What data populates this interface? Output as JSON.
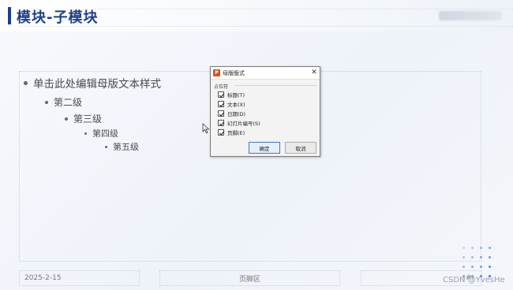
{
  "slide": {
    "title": "模块-子模块",
    "levels": [
      "单击此处编辑母版文本样式",
      "第二级",
      "第三级",
      "第四级",
      "第五级"
    ],
    "footer": {
      "date": "2025-2-15",
      "footer_area": "页脚区",
      "slide_number": "‹#›"
    }
  },
  "dialog": {
    "app_icon_label": "P",
    "title": "母版版式",
    "close_label": "✕",
    "group_label": "占位符",
    "checkboxes": [
      {
        "label": "标题(T)",
        "checked": true
      },
      {
        "label": "文本(X)",
        "checked": true
      },
      {
        "label": "日期(D)",
        "checked": true
      },
      {
        "label": "幻灯片编号(S)",
        "checked": true
      },
      {
        "label": "页脚(E)",
        "checked": true
      }
    ],
    "ok_label": "确定",
    "cancel_label": "取消"
  },
  "watermark": "CSDN @YvesHe",
  "colors": {
    "title_accent": "#1d3f8a",
    "deco_dot_blue": "#3d7dd6"
  }
}
